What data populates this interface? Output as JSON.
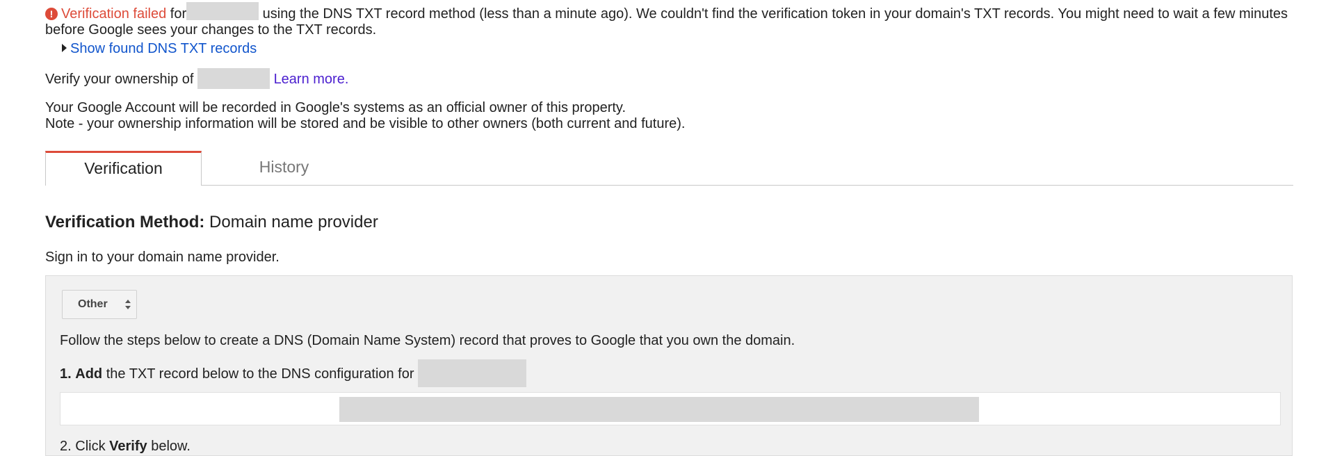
{
  "error": {
    "icon": "error-icon",
    "title": "Verification failed",
    "prefix": "for",
    "message": " using the DNS TXT record method (less than a minute ago). We couldn't find the verification token in your domain's TXT records. You might need to wait a few minutes before Google sees your changes to the TXT records.",
    "color": "#dd4b39"
  },
  "show_found": {
    "label": "Show found DNS TXT records"
  },
  "ownership": {
    "prefix": "Verify your ownership of",
    "learn_more": "Learn more."
  },
  "account": {
    "line1": "Your Google Account will be recorded in Google's systems as an official owner of this property.",
    "line2": "Note - your ownership information will be stored and be visible to other owners (both current and future)."
  },
  "tabs": [
    {
      "label": "Verification",
      "active": true
    },
    {
      "label": "History",
      "active": false
    }
  ],
  "method": {
    "label": "Verification Method:",
    "value": "Domain name provider"
  },
  "signin": "Sign in to your domain name provider.",
  "provider_select": {
    "value": "Other"
  },
  "steps": {
    "intro": "Follow the steps below to create a DNS (Domain Name System) record that proves to Google that you own the domain.",
    "step1_num": "1.",
    "step1_bold": "Add",
    "step1_text": "the TXT record below to the DNS configuration for",
    "step2_num": "2.",
    "step2_text": "Click",
    "step2_bold": "Verify",
    "step2_suffix": "below."
  },
  "colors": {
    "accent_red": "#dd4b39",
    "link_blue": "#1155cc",
    "link_purple": "#4b1fcf",
    "panel_bg": "#f1f1f1",
    "redaction": "#d9d9d9"
  }
}
